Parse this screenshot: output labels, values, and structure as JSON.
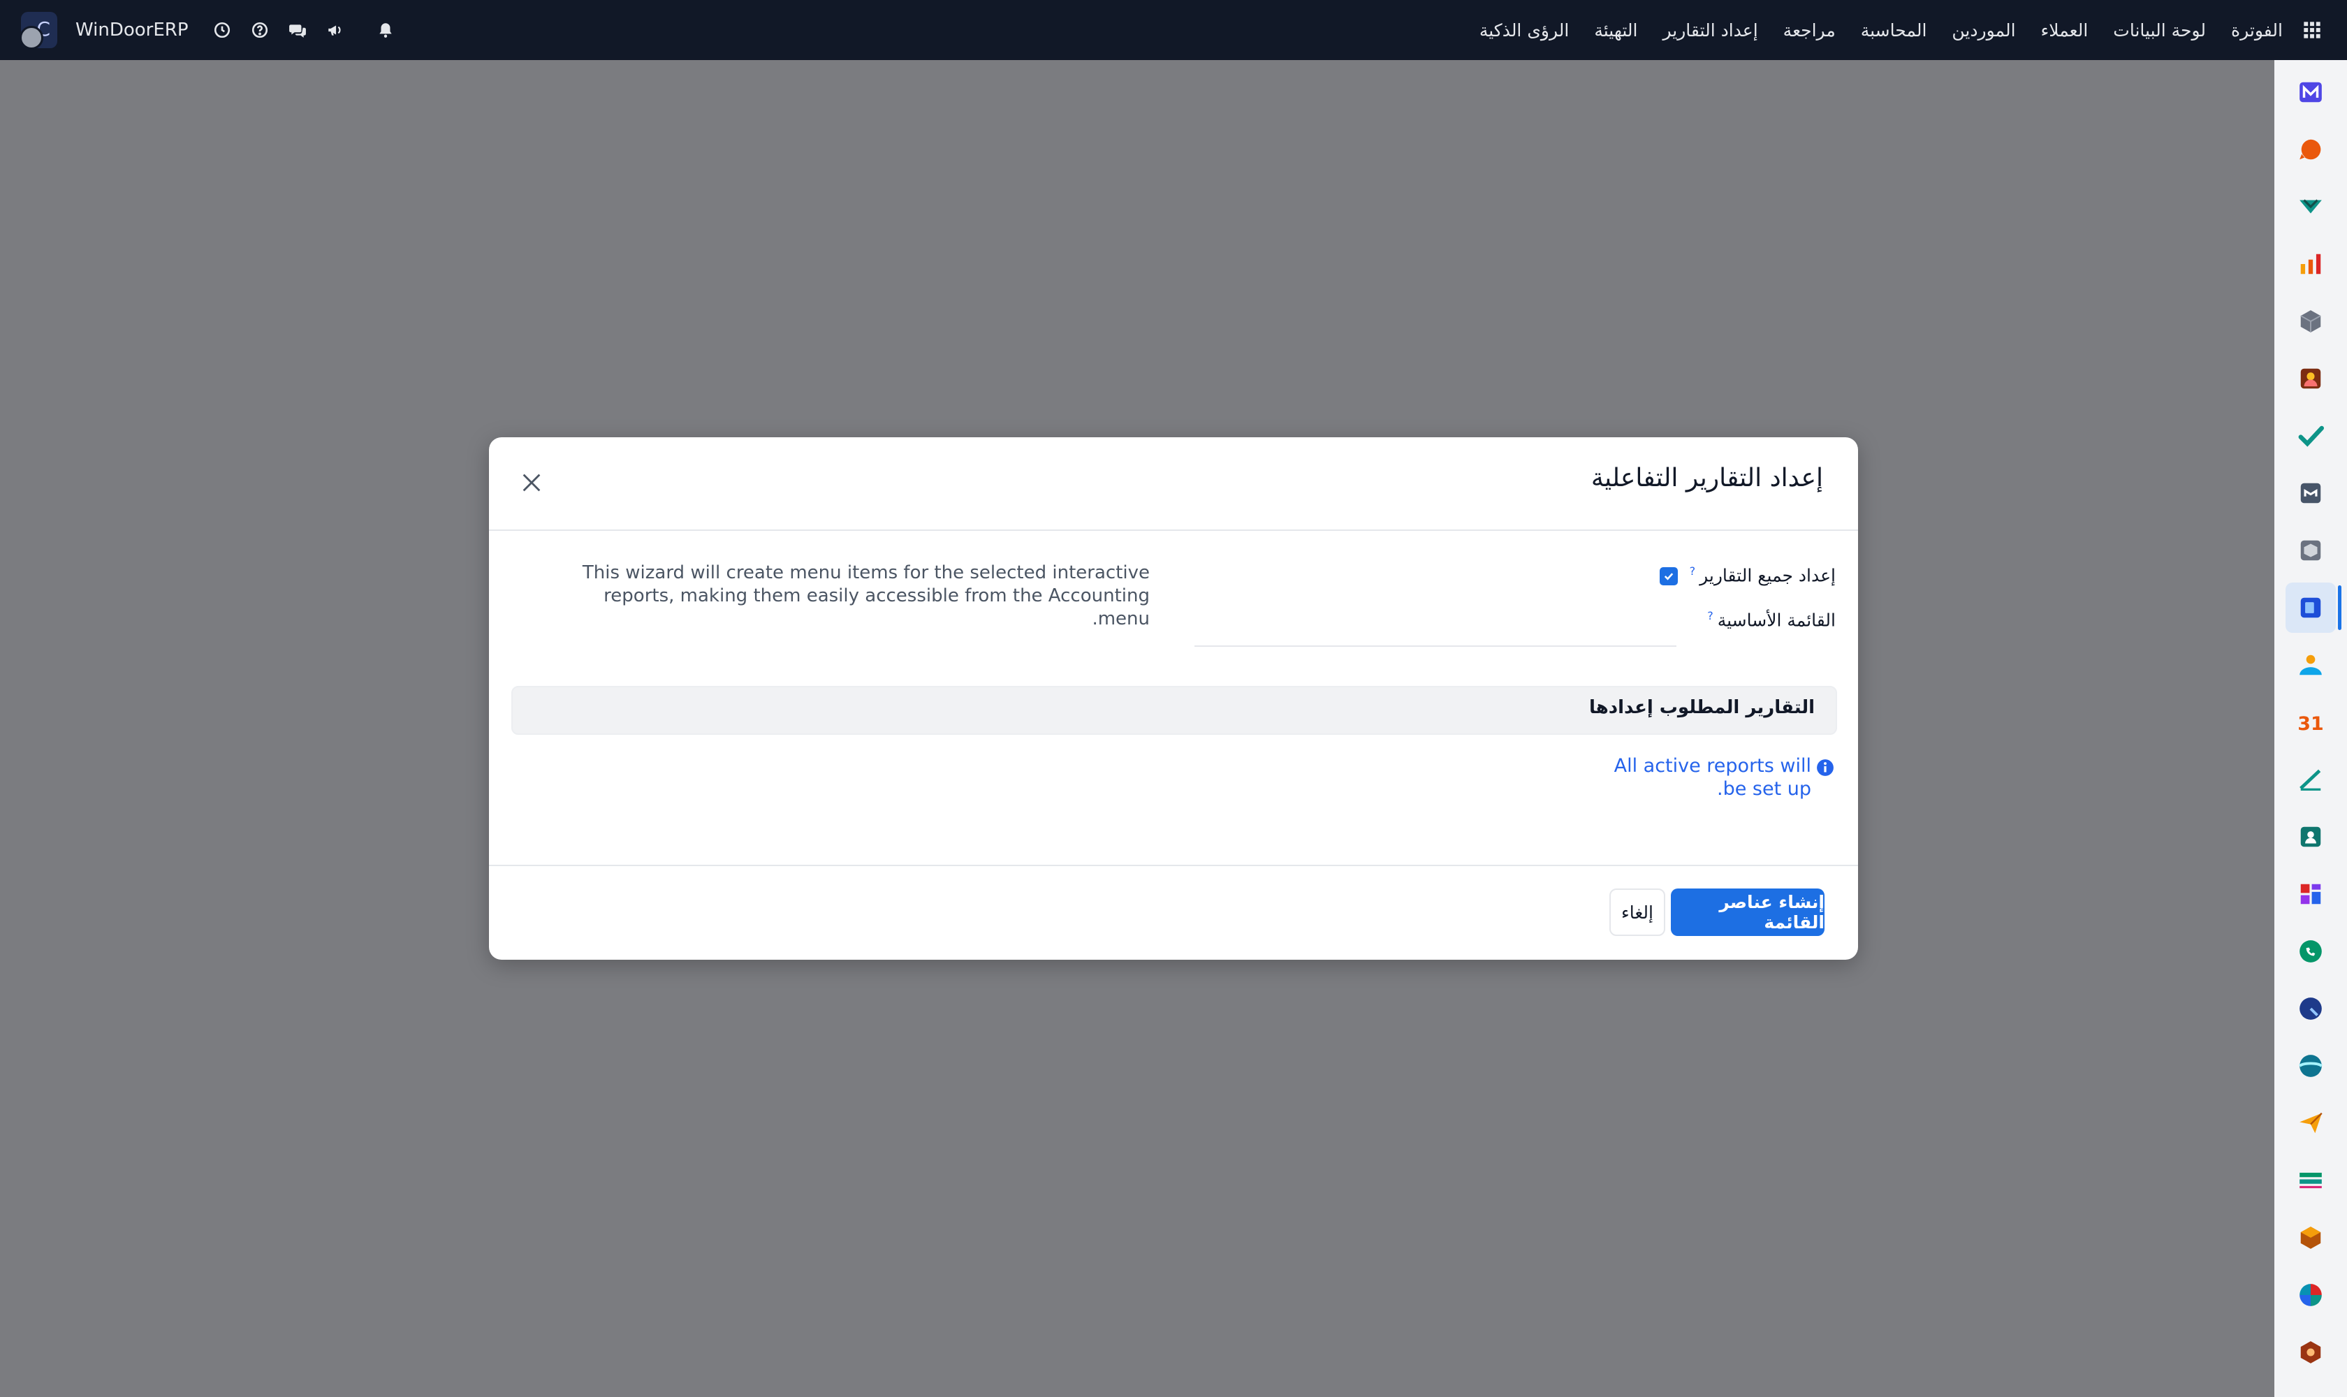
{
  "navbar": {
    "company": "WinDoorERP",
    "menu_items": [
      "الفوترة",
      "لوحة البيانات",
      "العملاء",
      "الموردين",
      "المحاسبة",
      "مراجعة",
      "إعداد التقارير",
      "التهيئة",
      "الرؤى الذكية"
    ]
  },
  "dialog": {
    "title": "إعداد التقارير التفاعلية",
    "setup_all_label": "إعداد جميع التقارير",
    "setup_all_checked": true,
    "main_menu_label": "القائمة الأساسية",
    "help_mark": "?",
    "wizard_text": "This wizard will create menu items for the selected interactive reports, making them easily accessible from the Accounting menu.",
    "section_title": "التقارير المطلوب إعدادها",
    "info_text": "All active reports will be set up.",
    "primary_button": "إنشاء عناصر القائمة",
    "cancel_button": "إلغاء"
  },
  "colors": {
    "accent": "#1d6fe3",
    "navbar_bg": "#111827",
    "overlay": "#7b7c80"
  }
}
